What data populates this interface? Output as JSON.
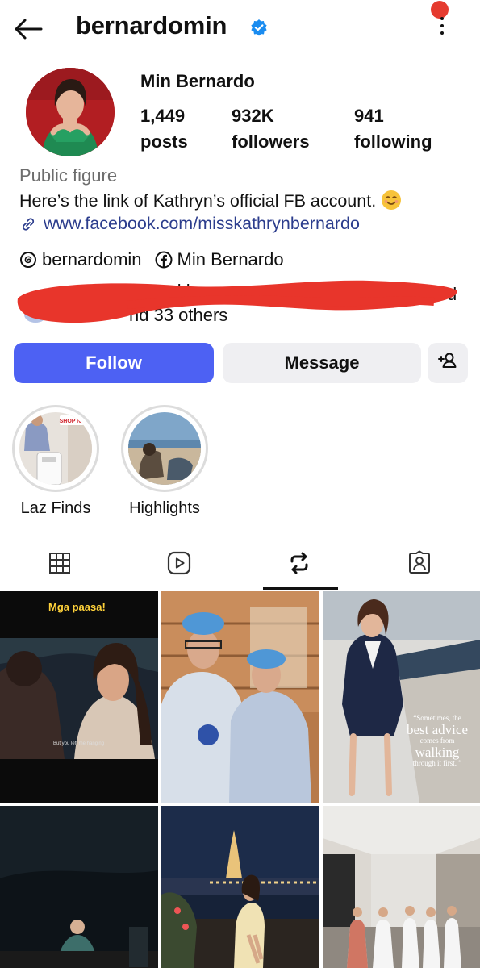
{
  "header": {
    "username": "bernardomin",
    "back_icon": "arrow-left-icon",
    "verified_icon": "verified-badge-icon",
    "menu_icon": "kebab-menu-icon",
    "notification_dot_color": "#e53b2f"
  },
  "profile": {
    "display_name": "Min Bernardo",
    "stats": [
      {
        "value": "1,449",
        "label": "posts"
      },
      {
        "value": "932K",
        "label": "followers"
      },
      {
        "value": "941",
        "label": "following"
      }
    ],
    "category": "Public figure",
    "bio": "Here’s the link of Kathryn’s official FB account.",
    "bio_emoji": "smiling-face-emoji",
    "link": "www.facebook.com/misskathrynbernardo",
    "threads_handle": "bernardomin",
    "facebook_name": "Min Bernardo",
    "followed_by_partial": "ollowed by",
    "followed_by_tail": "nd 33 others",
    "followed_by_d": "d"
  },
  "actions": {
    "follow_label": "Follow",
    "message_label": "Message",
    "add_person_icon": "add-person-icon",
    "accent_color": "#4d61f3"
  },
  "highlights": [
    {
      "label": "Laz Finds",
      "badge": "SHOP NOW"
    },
    {
      "label": "Highlights"
    }
  ],
  "tabs": [
    {
      "icon": "grid-icon"
    },
    {
      "icon": "reels-icon"
    },
    {
      "icon": "reposts-icon",
      "active": true
    },
    {
      "icon": "tagged-icon"
    }
  ],
  "posts": [
    {
      "caption": "Mga paasa!",
      "subtitle": "But you left me hanging"
    },
    {},
    {
      "quote_lines": [
        "“Sometimes, the",
        "best advice",
        "comes from",
        "walking",
        "through it first. ”"
      ]
    },
    {},
    {},
    {}
  ]
}
